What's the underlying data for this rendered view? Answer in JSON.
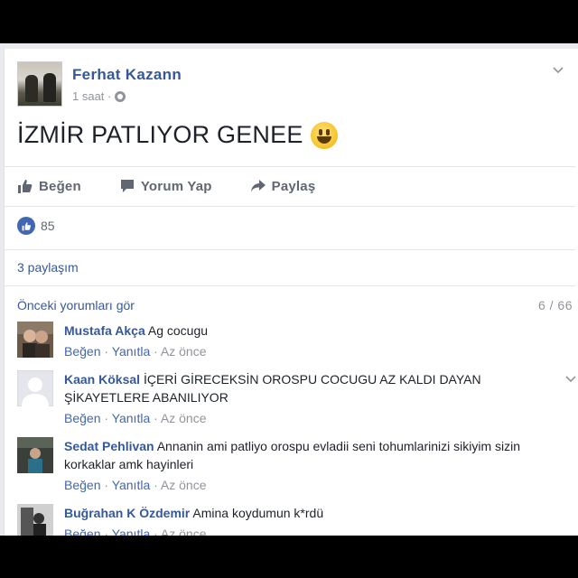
{
  "post": {
    "author": "Ferhat Kazann",
    "time": "1 saat ·",
    "text": "İZMİR PATLIYOR GENEE",
    "emoji_icon": "smiley-icon"
  },
  "actions": {
    "like": "Beğen",
    "comment": "Yorum Yap",
    "share": "Paylaş"
  },
  "reactions": {
    "count": "85"
  },
  "shares": {
    "label": "3 paylaşım"
  },
  "comments_section": {
    "previous_label": "Önceki yorumları gör",
    "count": "6 / 66"
  },
  "comments": [
    {
      "name": "Mustafa Akça",
      "text": "Ag cocugu",
      "like": "Beğen",
      "reply": "Yanıtla",
      "time": "Az önce"
    },
    {
      "name": "Kaan Köksal",
      "text": "İÇERİ GİRECEKSİN OROSPU COCUGU AZ KALDI DAYAN ŞİKAYETLERE ABANILIYOR",
      "like": "Beğen",
      "reply": "Yanıtla",
      "time": "Az önce"
    },
    {
      "name": "Sedat Pehlivan",
      "text": "Annanin ami patliyo orospu evladii seni tohumlarinizi sikiyim sizin korkaklar amk hayinleri",
      "like": "Beğen",
      "reply": "Yanıtla",
      "time": "Az önce"
    },
    {
      "name": "Buğrahan K Özdemir",
      "text": "Amina koydumun k*rdü",
      "like": "Beğen",
      "reply": "Yanıtla",
      "time": "Az önce"
    }
  ],
  "colors": {
    "link": "#365899",
    "like_badge": "#4267b2",
    "muted": "#90949c"
  }
}
